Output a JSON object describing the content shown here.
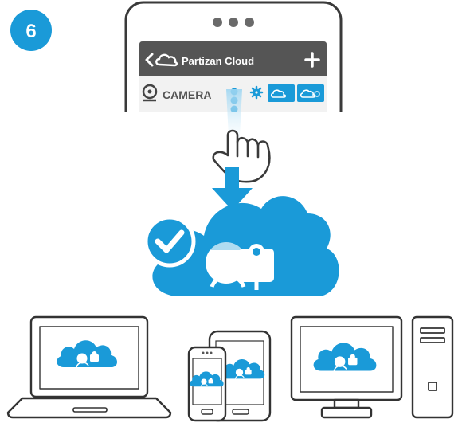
{
  "step": {
    "number": "6"
  },
  "app": {
    "title": "Partizan Cloud",
    "camera_label": "CAMERA"
  },
  "colors": {
    "accent": "#1296d9",
    "header": "#555555",
    "outline": "#333333"
  },
  "icons": {
    "back": "chevron-left-icon",
    "cloud": "cloud-icon",
    "add": "plus-icon",
    "camera": "camera-icon",
    "more": "vertical-dots-icon",
    "settings": "gear-icon",
    "tap": "hand-pointer-icon",
    "arrow": "arrow-down-icon",
    "check": "checkmark-icon"
  }
}
